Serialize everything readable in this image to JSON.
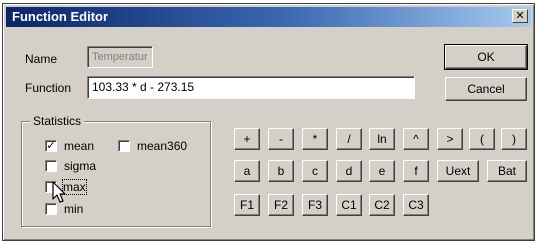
{
  "window": {
    "title": "Function Editor",
    "close_glyph": "✕"
  },
  "name": {
    "label": "Name",
    "value": "Temperatur"
  },
  "function": {
    "label": "Function",
    "value": "103.33 * d - 273.15"
  },
  "buttons": {
    "ok": "OK",
    "cancel": "Cancel"
  },
  "statistics": {
    "title": "Statistics",
    "items": [
      {
        "label": "mean",
        "checked": "✓"
      },
      {
        "label": "mean360",
        "checked": ""
      },
      {
        "label": "sigma",
        "checked": ""
      },
      {
        "label": "max",
        "checked": ""
      },
      {
        "label": "min",
        "checked": ""
      }
    ]
  },
  "keypad": {
    "row1": [
      "+",
      "-",
      "*",
      "/",
      "ln",
      "^",
      ">",
      "(",
      ")"
    ],
    "row2": [
      "a",
      "b",
      "c",
      "d",
      "e",
      "f",
      "Uext",
      "Bat"
    ],
    "row3": [
      "F1",
      "F2",
      "F3",
      "C1",
      "C2",
      "C3"
    ]
  },
  "cursor_icon": "mouse-pointer"
}
